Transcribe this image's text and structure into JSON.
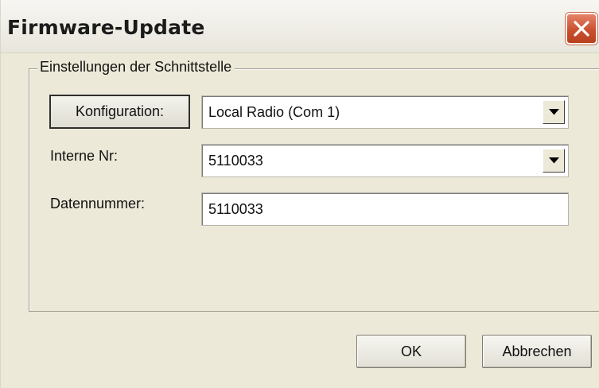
{
  "window": {
    "title": "Firmware-Update"
  },
  "group": {
    "legend": "Einstellungen der Schnittstelle"
  },
  "form": {
    "config_button_label": "Konfiguration:",
    "config_value": "Local Radio (Com 1)",
    "intern_label": "Interne Nr:",
    "intern_value": "5110033",
    "data_label": "Datennummer:",
    "data_value": "5110033"
  },
  "footer": {
    "ok_label": "OK",
    "cancel_label": "Abbrechen"
  },
  "icons": {
    "close": "close-icon",
    "dropdown": "chevron-down-icon"
  },
  "colors": {
    "dialog_bg": "#ece9d8",
    "close_button": "#c9512f"
  }
}
